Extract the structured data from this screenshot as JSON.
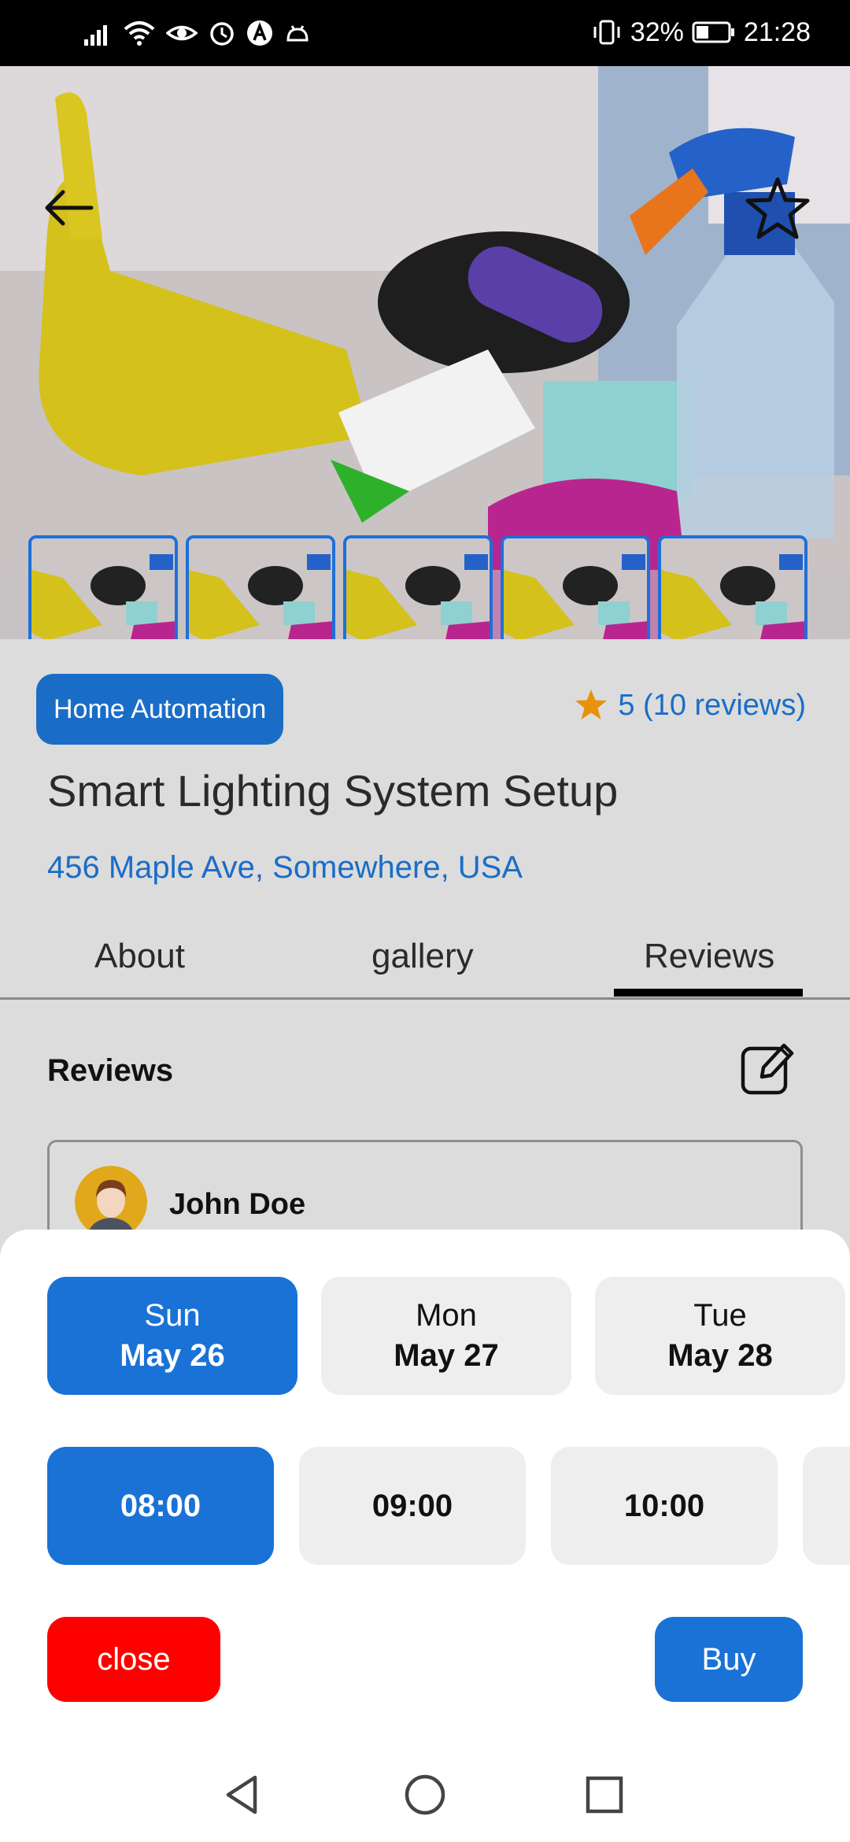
{
  "status_bar": {
    "battery_percent": "32%",
    "time": "21:28"
  },
  "hero": {
    "thumbnail_count": 5
  },
  "service": {
    "category": "Home Automation",
    "rating_text": "5 (10 reviews)",
    "title": "Smart Lighting System Setup",
    "address": "456 Maple Ave, Somewhere, USA"
  },
  "tabs": [
    {
      "label": "About"
    },
    {
      "label": "gallery"
    },
    {
      "label": "Reviews"
    }
  ],
  "reviews": {
    "heading": "Reviews",
    "items": [
      {
        "name": "John Doe"
      }
    ]
  },
  "booking": {
    "dates": [
      {
        "day": "Sun",
        "date": "May 26",
        "selected": true
      },
      {
        "day": "Mon",
        "date": "May 27",
        "selected": false
      },
      {
        "day": "Tue",
        "date": "May 28",
        "selected": false
      }
    ],
    "times": [
      {
        "label": "08:00",
        "selected": true
      },
      {
        "label": "09:00",
        "selected": false
      },
      {
        "label": "10:00",
        "selected": false
      }
    ],
    "close_label": "close",
    "buy_label": "Buy"
  },
  "colors": {
    "primary": "#1a72d6",
    "danger": "#ff0000",
    "star": "#e8920c"
  }
}
